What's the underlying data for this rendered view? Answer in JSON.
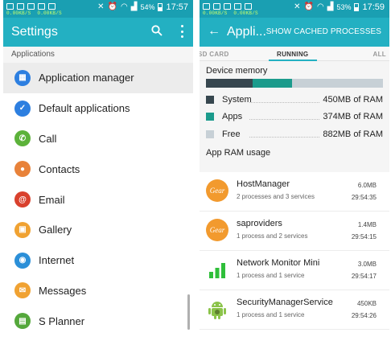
{
  "left": {
    "status": {
      "speed_up": "0.00KB/S",
      "speed_down": "0.00KB/S",
      "battery": "54%",
      "time": "17:57"
    },
    "appbar": {
      "title": "Settings"
    },
    "section_label": "Applications",
    "items": [
      {
        "label": "Application manager",
        "icon": "grid-icon",
        "color": "#2d7fe0",
        "glyph": "▦"
      },
      {
        "label": "Default applications",
        "icon": "grid-check-icon",
        "color": "#2d7fe0",
        "glyph": "✓"
      },
      {
        "label": "Call",
        "icon": "phone-icon",
        "color": "#5cb23a",
        "glyph": "✆"
      },
      {
        "label": "Contacts",
        "icon": "person-icon",
        "color": "#e8823a",
        "glyph": "👤"
      },
      {
        "label": "Email",
        "icon": "at-icon",
        "color": "#d9412d",
        "glyph": "@"
      },
      {
        "label": "Gallery",
        "icon": "image-icon",
        "color": "#f0a232",
        "glyph": "▣"
      },
      {
        "label": "Internet",
        "icon": "globe-icon",
        "color": "#2b8fd8",
        "glyph": "◉"
      },
      {
        "label": "Messages",
        "icon": "message-icon",
        "color": "#f0a232",
        "glyph": "✉"
      },
      {
        "label": "S Planner",
        "icon": "calendar-icon",
        "color": "#55a83c",
        "glyph": "▤"
      }
    ]
  },
  "right": {
    "status": {
      "speed_up": "0.00KB/S",
      "speed_down": "0.00KB/S",
      "battery": "53%",
      "time": "17:59"
    },
    "appbar": {
      "title": "Appli...",
      "action": "SHOW CACHED PROCESSES"
    },
    "tabs": {
      "sd": "SD CARD",
      "running": "RUNNING",
      "all": "ALL"
    },
    "memory": {
      "title": "Device memory",
      "bar": {
        "system_fraction": 0.265,
        "apps_fraction": 0.22,
        "free_fraction": 0.515
      },
      "rows": [
        {
          "name": "System",
          "value": "450MB of RAM",
          "color": "#37474f"
        },
        {
          "name": "Apps",
          "value": "374MB of RAM",
          "color": "#1b9b8c"
        },
        {
          "name": "Free",
          "value": "882MB of RAM",
          "color": "#c7d0d6"
        }
      ]
    },
    "usage_title": "App RAM usage",
    "processes": [
      {
        "name": "HostManager",
        "sub": "2 processes and 3 services",
        "size": "6.0MB",
        "time": "29:54:35",
        "icon": "gear-app-icon",
        "icon_text": "Gear"
      },
      {
        "name": "saproviders",
        "sub": "1 process and 2 services",
        "size": "1.4MB",
        "time": "29:54:15",
        "icon": "gear-app-icon",
        "icon_text": "Gear"
      },
      {
        "name": "Network Monitor Mini",
        "sub": "1 process and 1 service",
        "size": "3.0MB",
        "time": "29:54:17",
        "icon": "signal-bars-icon"
      },
      {
        "name": "SecurityManagerService",
        "sub": "1 process and 1 service",
        "size": "450KB",
        "time": "29:54:26",
        "icon": "android-icon"
      }
    ]
  }
}
